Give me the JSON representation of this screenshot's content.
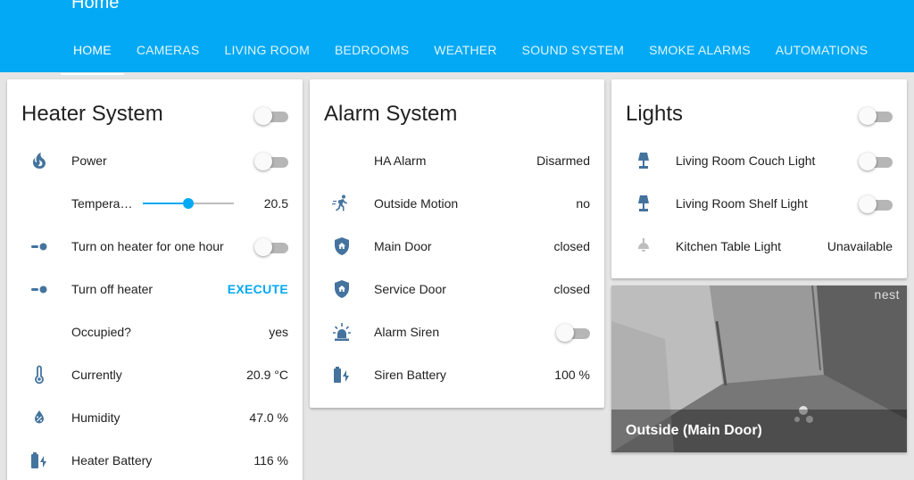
{
  "app": {
    "title": "Home"
  },
  "tabs": [
    {
      "label": "HOME",
      "active": true
    },
    {
      "label": "CAMERAS"
    },
    {
      "label": "LIVING ROOM"
    },
    {
      "label": "BEDROOMS"
    },
    {
      "label": "WEATHER"
    },
    {
      "label": "SOUND SYSTEM"
    },
    {
      "label": "SMOKE ALARMS"
    },
    {
      "label": "AUTOMATIONS"
    }
  ],
  "heater": {
    "title": "Heater System",
    "toggle_on": false,
    "rows": [
      {
        "icon": "fire-icon",
        "label": "Power",
        "toggle_on": false
      },
      {
        "label": "Tempera…",
        "value": "20.5",
        "slider_fraction": 0.5
      },
      {
        "icon": "script-icon",
        "label": "Turn on heater for one hour",
        "toggle_on": false
      },
      {
        "icon": "script-icon",
        "label": "Turn off heater",
        "value": "EXECUTE"
      },
      {
        "label": "Occupied?",
        "value": "yes"
      },
      {
        "icon": "thermometer-icon",
        "label": "Currently",
        "value": "20.9 °C"
      },
      {
        "icon": "humidity-icon",
        "label": "Humidity",
        "value": "47.0 %"
      },
      {
        "icon": "battery-charging-icon",
        "label": "Heater Battery",
        "value": "116 %"
      }
    ]
  },
  "alarm": {
    "title": "Alarm System",
    "rows": [
      {
        "label": "HA Alarm",
        "value": "Disarmed"
      },
      {
        "icon": "motion-icon",
        "label": "Outside Motion",
        "value": "no"
      },
      {
        "icon": "shield-home-icon",
        "label": "Main Door",
        "value": "closed"
      },
      {
        "icon": "shield-home-icon",
        "label": "Service Door",
        "value": "closed"
      },
      {
        "icon": "alarm-light-icon",
        "label": "Alarm Siren",
        "toggle_on": false
      },
      {
        "icon": "battery-charging-icon",
        "label": "Siren Battery",
        "value": "100 %"
      }
    ]
  },
  "lights": {
    "title": "Lights",
    "toggle_on": false,
    "rows": [
      {
        "icon": "lamp-icon",
        "label": "Living Room Couch Light",
        "toggle_on": false
      },
      {
        "icon": "lamp-icon",
        "label": "Living Room Shelf Light",
        "toggle_on": false
      },
      {
        "icon": "ceiling-light-icon",
        "label": "Kitchen Table Light",
        "value": "Unavailable"
      }
    ]
  },
  "camera": {
    "name": "Outside (Main Door)",
    "logo": "nest"
  },
  "colors": {
    "accent": "#03a9f4",
    "icon": "#44739e",
    "icon_disabled": "#bdbdbd"
  }
}
